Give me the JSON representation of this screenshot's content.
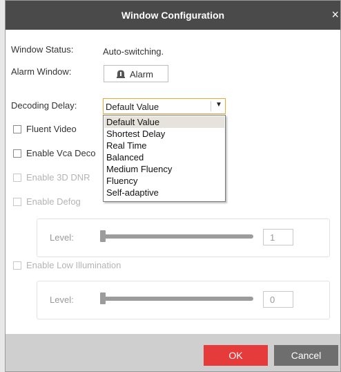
{
  "window": {
    "title": "Window Configuration",
    "close": "×"
  },
  "window_status": {
    "label": "Window Status:",
    "value": "Auto-switching."
  },
  "alarm_window": {
    "label": "Alarm Window:",
    "button_label": "Alarm"
  },
  "decoding_delay": {
    "label": "Decoding Delay:",
    "selected": "Default Value",
    "options": [
      "Default Value",
      "Shortest Delay",
      "Real Time",
      "Balanced",
      "Medium Fluency",
      "Fluency",
      "Self-adaptive"
    ]
  },
  "checkboxes": {
    "fluent_video": "Fluent Video",
    "enable_vca": "Enable Vca Deco",
    "enable_3d_dnr": "Enable 3D DNR",
    "enable_defog": "Enable Defog",
    "enable_low_illumination": "Enable Low Illumination"
  },
  "defog_level": {
    "label": "Level:",
    "value": "1"
  },
  "low_illumination_level": {
    "label": "Level:",
    "value": "0"
  },
  "footer": {
    "ok": "OK",
    "cancel": "Cancel"
  },
  "colors": {
    "titlebar": "#4a4a4a",
    "ok": "#e63b3b",
    "cancel": "#6e6e6e",
    "accent": "#e8a93a"
  }
}
